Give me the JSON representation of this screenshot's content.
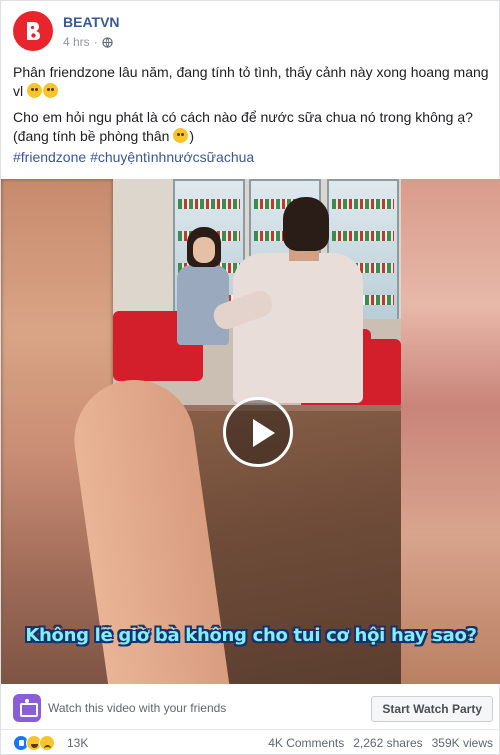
{
  "post": {
    "page_name": "BEATVN",
    "timestamp": "4 hrs",
    "privacy_icon": "globe-icon",
    "avatar_icon": "beatvn-logo",
    "text_line_1": "Phân friendzone lâu năm, đang tính tỏ tình, thấy cảnh này xong hoang mang vl",
    "text_line_2": "Cho em hỏi ngu phát là có cách nào để nước sữa chua nó trong không ạ? (đang tính bề phòng thân",
    "text_line_2_end": ")",
    "hashtag_1": "#friendzone",
    "hashtag_2": "#chuyệntìnhnướcsữachua"
  },
  "video": {
    "subtitle": "Không lẽ giờ bà không cho tui cơ hội hay sao?",
    "play_icon": "play-icon"
  },
  "watch_party": {
    "prompt": "Watch this video with your friends",
    "button_label": "Start Watch Party",
    "icon": "watch-party-icon"
  },
  "engagement": {
    "reaction_count": "13K",
    "comments": "4K Comments",
    "shares": "2,262 shares",
    "views": "359K views"
  },
  "colors": {
    "brand_red": "#e8242c",
    "link_blue": "#385898",
    "subtitle_cyan": "#7ff0f5",
    "watch_party_purple": "#8b5dd6"
  }
}
